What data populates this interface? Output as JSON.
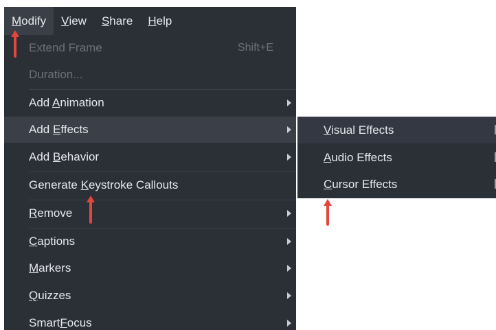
{
  "menubar": {
    "items": [
      {
        "pre": "",
        "ul": "M",
        "post": "odify"
      },
      {
        "pre": "",
        "ul": "V",
        "post": "iew"
      },
      {
        "pre": "",
        "ul": "S",
        "post": "hare"
      },
      {
        "pre": "",
        "ul": "H",
        "post": "elp"
      }
    ]
  },
  "modify_menu": {
    "items": [
      {
        "pre": "Extend Frame",
        "ul": "",
        "post": "",
        "shortcut": "Shift+E"
      },
      {
        "pre": "Duration...",
        "ul": "",
        "post": ""
      },
      {
        "pre": "Add ",
        "ul": "A",
        "post": "nimation"
      },
      {
        "pre": "Add ",
        "ul": "E",
        "post": "ffects"
      },
      {
        "pre": "Add ",
        "ul": "B",
        "post": "ehavior"
      },
      {
        "pre": "Generate ",
        "ul": "K",
        "post": "eystroke Callouts"
      },
      {
        "pre": "",
        "ul": "R",
        "post": "emove"
      },
      {
        "pre": "",
        "ul": "C",
        "post": "aptions"
      },
      {
        "pre": "",
        "ul": "M",
        "post": "arkers"
      },
      {
        "pre": "",
        "ul": "Q",
        "post": "uizzes"
      },
      {
        "pre": "Smart",
        "ul": "F",
        "post": "ocus"
      }
    ]
  },
  "effects_submenu": {
    "items": [
      {
        "pre": "",
        "ul": "V",
        "post": "isual Effects"
      },
      {
        "pre": "",
        "ul": "A",
        "post": "udio Effects"
      },
      {
        "pre": "",
        "ul": "C",
        "post": "ursor Effects"
      }
    ]
  },
  "colors": {
    "menu_bg": "#2b2f36",
    "highlight": "#3a3f48",
    "text": "#e6e8ec",
    "disabled": "#6c7079",
    "annotation_arrow": "#e5463c"
  },
  "icons": {
    "submenu_arrow": "triangle-right",
    "annotation": "red-up-arrow"
  }
}
